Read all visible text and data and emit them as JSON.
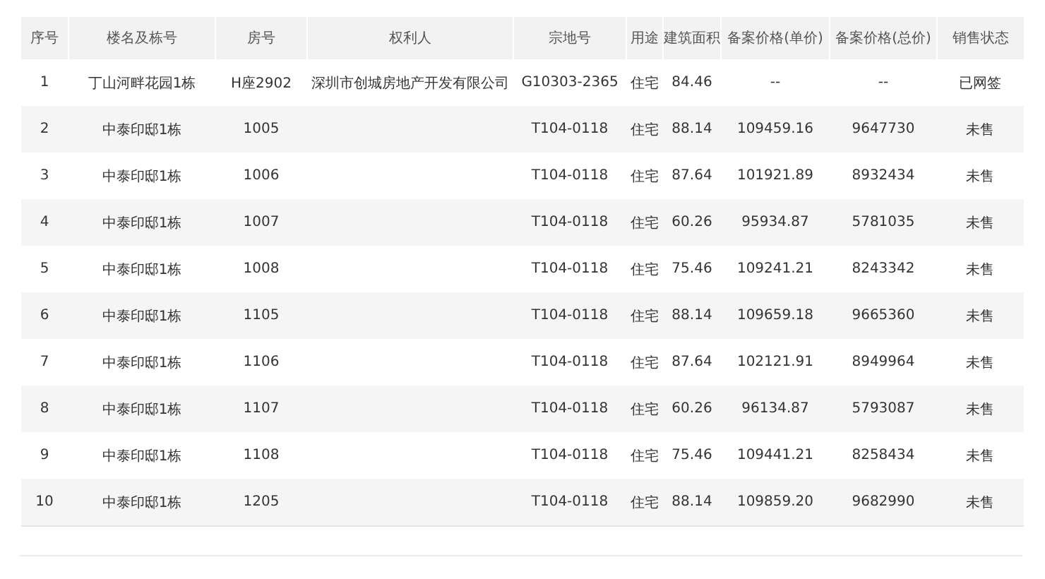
{
  "table": {
    "columns": [
      "序号",
      "楼名及栋号",
      "房号",
      "权利人",
      "宗地号",
      "用途",
      "建筑面积",
      "备案价格(单价)",
      "备案价格(总价)",
      "销售状态"
    ],
    "rows": [
      [
        "1",
        "丁山河畔花园1栋",
        "H座2902",
        "深圳市创城房地产开发有限公司",
        "G10303-2365",
        "住宅",
        "84.46",
        "--",
        "--",
        "已网签"
      ],
      [
        "2",
        "中泰印邸1栋",
        "1005",
        "",
        "T104-0118",
        "住宅",
        "88.14",
        "109459.16",
        "9647730",
        "未售"
      ],
      [
        "3",
        "中泰印邸1栋",
        "1006",
        "",
        "T104-0118",
        "住宅",
        "87.64",
        "101921.89",
        "8932434",
        "未售"
      ],
      [
        "4",
        "中泰印邸1栋",
        "1007",
        "",
        "T104-0118",
        "住宅",
        "60.26",
        "95934.87",
        "5781035",
        "未售"
      ],
      [
        "5",
        "中泰印邸1栋",
        "1008",
        "",
        "T104-0118",
        "住宅",
        "75.46",
        "109241.21",
        "8243342",
        "未售"
      ],
      [
        "6",
        "中泰印邸1栋",
        "1105",
        "",
        "T104-0118",
        "住宅",
        "88.14",
        "109659.18",
        "9665360",
        "未售"
      ],
      [
        "7",
        "中泰印邸1栋",
        "1106",
        "",
        "T104-0118",
        "住宅",
        "87.64",
        "102121.91",
        "8949964",
        "未售"
      ],
      [
        "8",
        "中泰印邸1栋",
        "1107",
        "",
        "T104-0118",
        "住宅",
        "60.26",
        "96134.87",
        "5793087",
        "未售"
      ],
      [
        "9",
        "中泰印邸1栋",
        "1108",
        "",
        "T104-0118",
        "住宅",
        "75.46",
        "109441.21",
        "8258434",
        "未售"
      ],
      [
        "10",
        "中泰印邸1栋",
        "1205",
        "",
        "T104-0118",
        "住宅",
        "88.14",
        "109859.20",
        "9682990",
        "未售"
      ]
    ]
  }
}
